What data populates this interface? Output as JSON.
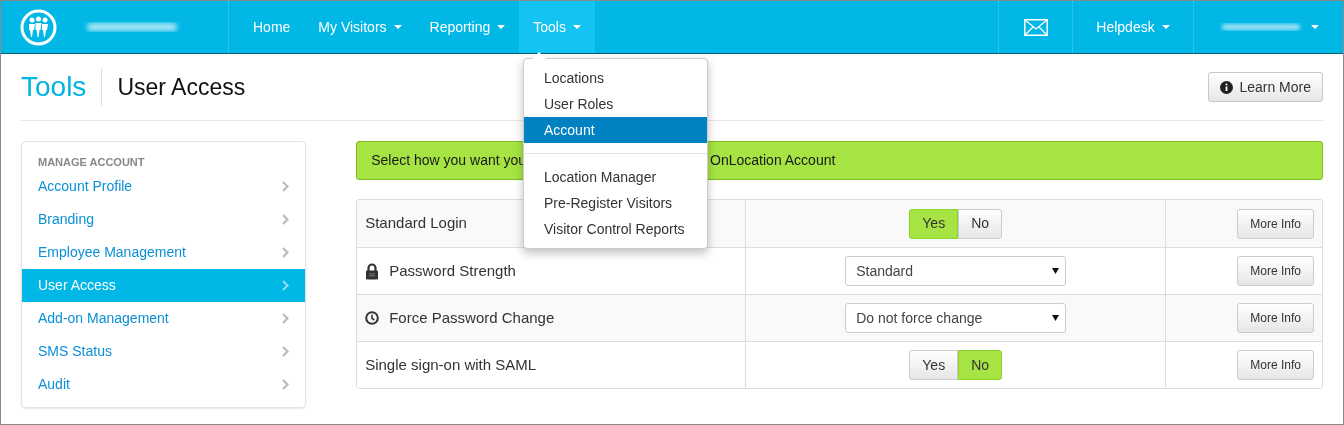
{
  "navbar": {
    "items": [
      {
        "label": "Home",
        "has_caret": false,
        "selected": false
      },
      {
        "label": "My Visitors",
        "has_caret": true,
        "selected": false
      },
      {
        "label": "Reporting",
        "has_caret": true,
        "selected": false
      },
      {
        "label": "Tools",
        "has_caret": true,
        "selected": true
      }
    ],
    "right_items": [
      {
        "kind": "mail"
      },
      {
        "kind": "menu",
        "label": "Helpdesk"
      },
      {
        "kind": "redacted"
      }
    ]
  },
  "tools_menu": {
    "groups": [
      [
        {
          "label": "Locations",
          "selected": false
        },
        {
          "label": "User Roles",
          "selected": false
        },
        {
          "label": "Account",
          "selected": true
        }
      ],
      [
        {
          "label": "Location Manager",
          "selected": false
        },
        {
          "label": "Pre-Register Visitors",
          "selected": false
        },
        {
          "label": "Visitor Control Reports",
          "selected": false
        }
      ]
    ]
  },
  "page_header": {
    "section": "Tools",
    "title": "User Access",
    "button": "Learn More"
  },
  "sidebar": {
    "heading": "MANAGE ACCOUNT",
    "items": [
      {
        "label": "Account Profile",
        "selected": false
      },
      {
        "label": "Branding",
        "selected": false
      },
      {
        "label": "Employee Management",
        "selected": false
      },
      {
        "label": "User Access",
        "selected": true
      },
      {
        "label": "Add-on Management",
        "selected": false
      },
      {
        "label": "SMS Status",
        "selected": false
      },
      {
        "label": "Audit",
        "selected": false
      }
    ]
  },
  "alert": {
    "text_start": "Select how you want you",
    "text_end": "OnLocation Account"
  },
  "settings": {
    "rows": [
      {
        "label": "Standard Login",
        "kind": "toggle",
        "options": [
          {
            "label": "Yes",
            "selected": true
          },
          {
            "label": "No",
            "selected": false
          }
        ],
        "button": "More Info"
      },
      {
        "label": "Password Strength",
        "icon": {
          "kind": "lock"
        },
        "kind": "select",
        "value": "Standard",
        "button": "More Info"
      },
      {
        "label": "Force Password Change",
        "icon": {
          "kind": "clock"
        },
        "kind": "select",
        "value": "Do not force change",
        "button": "More Info"
      },
      {
        "label": "Single sign-on with SAML",
        "kind": "toggle",
        "options": [
          {
            "label": "Yes",
            "selected": false
          },
          {
            "label": "No",
            "selected": true
          }
        ],
        "button": "More Info"
      }
    ]
  }
}
